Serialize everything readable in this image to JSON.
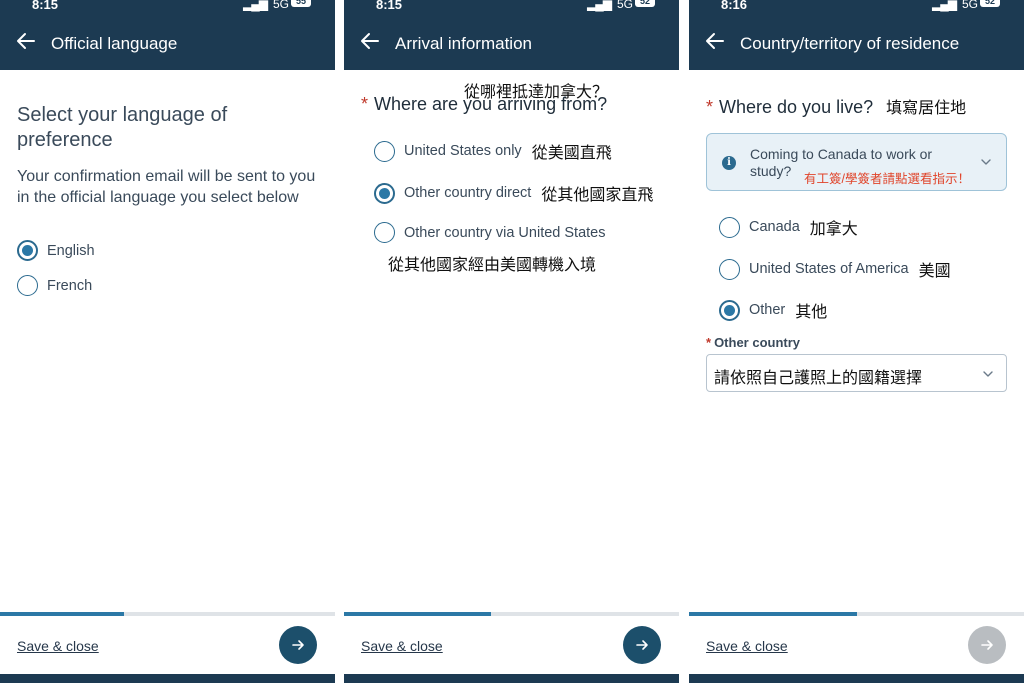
{
  "colors": {
    "header": "#1c3a52",
    "accent": "#2b78a6",
    "required": "#c0392b",
    "annotation_red": "#e0442a"
  },
  "panels": [
    {
      "status": {
        "time": "8:15",
        "network": "5G",
        "battery": "55"
      },
      "title": "Official language",
      "heading": "Select your language of preference",
      "description": "Your confirmation email will be sent to you in the official language you select below",
      "options": [
        {
          "label": "English",
          "selected": true
        },
        {
          "label": "French",
          "selected": false
        }
      ],
      "progress": 0.37,
      "save_label": "Save & close",
      "next_enabled": true
    },
    {
      "status": {
        "time": "8:15",
        "network": "5G",
        "battery": "52"
      },
      "title": "Arrival information",
      "annotation_question": "從哪裡抵達加拿大？",
      "required_mark": "*",
      "question": "Where are you arriving from?",
      "options": [
        {
          "label": "United States only",
          "note": "從美國直飛",
          "selected": false
        },
        {
          "label": "Other country direct",
          "note": "從其他國家直飛",
          "selected": true
        },
        {
          "label": "Other country via United States",
          "note": "",
          "selected": false
        }
      ],
      "annotation_via": "從其他國家經由美國轉機入境",
      "progress": 0.44,
      "save_label": "Save & close",
      "next_enabled": true
    },
    {
      "status": {
        "time": "8:16",
        "network": "5G",
        "battery": "52"
      },
      "title": "Country/territory of residence",
      "required_mark": "*",
      "question": "Where do you live?",
      "question_note": "填寫居住地",
      "info_text_line1": "Coming to Canada to work or",
      "info_text_line2": "study?",
      "info_red_note": "有工簽/學簽者請點選看指示！",
      "options": [
        {
          "label": "Canada",
          "note": "加拿大",
          "selected": false
        },
        {
          "label": "United States of America",
          "note": "美國",
          "selected": false
        },
        {
          "label": "Other",
          "note": "其他",
          "selected": true
        }
      ],
      "other_country_label": "Other country",
      "other_country_value": "請依照自己護照上的國籍選擇",
      "progress": 0.5,
      "save_label": "Save & close",
      "next_enabled": false
    }
  ]
}
